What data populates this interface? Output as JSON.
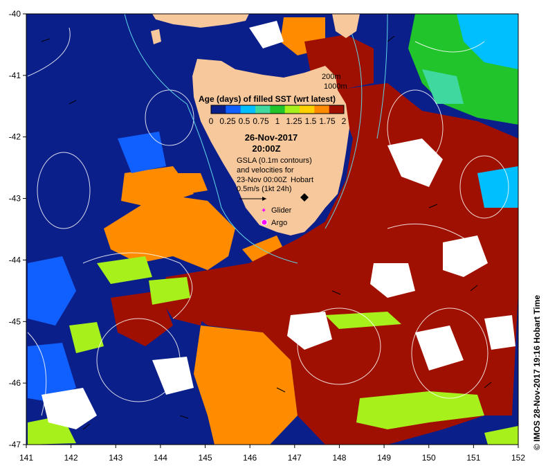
{
  "map": {
    "lon_min": 141,
    "lon_max": 152,
    "lat_min": -47,
    "lat_max": -40,
    "x_ticks": [
      "141",
      "142",
      "143",
      "144",
      "145",
      "146",
      "147",
      "148",
      "149",
      "150",
      "151",
      "152"
    ],
    "y_ticks": [
      "-40",
      "-41",
      "-42",
      "-43",
      "-44",
      "-45",
      "-46",
      "-47"
    ],
    "land_color": "#f7c89b",
    "ocean_color": "#0b1f8a"
  },
  "depth_labels": {
    "d200": "200m",
    "d1000": "1000m"
  },
  "legend": {
    "title": "Age (days) of filled SST (wrt latest)",
    "ticks": [
      "0",
      "0.25",
      "0.5",
      "0.75",
      "1",
      "1.25",
      "1.5",
      "1.75",
      "2"
    ],
    "colors": [
      "#0b1f8a",
      "#1060ff",
      "#00bfff",
      "#3fd9a0",
      "#22c42c",
      "#a8f01c",
      "#ffd000",
      "#ff8c00",
      "#a01000"
    ]
  },
  "date": {
    "line1": "26-Nov-2017",
    "line2": "20:00Z"
  },
  "info": {
    "line1": "GSLA (0.1m contours)",
    "line2": "and velocities for",
    "line3": "23-Nov 00:00Z",
    "line4": "0.5m/s (1kt 24h)"
  },
  "places": {
    "hobart": "Hobart"
  },
  "symbols": {
    "glider": "Glider",
    "argo": "Argo"
  },
  "credit": "© IMOS 28-Nov-2017 19:16 Hobart Time"
}
